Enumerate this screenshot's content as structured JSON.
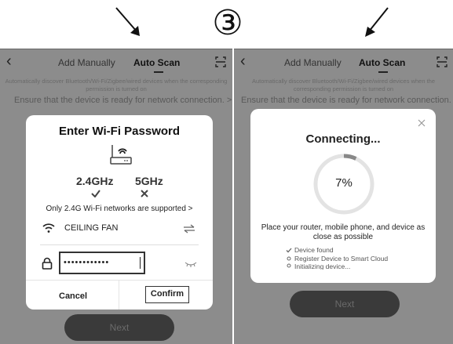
{
  "step_number": "③",
  "left_screen": {
    "back_icon": "chevron-left-icon",
    "tabs": [
      {
        "label": "Add Manually"
      },
      {
        "label": "Auto Scan"
      }
    ],
    "scan_icon": "scan-icon",
    "description": "Automatically discover Bluetooth/Wi-Fi/Zigbee/wired devices when the corresponding permission is turned on",
    "ensure_text": "Ensure that the device is ready for network connection. >",
    "dialog": {
      "title": "Enter Wi-Fi Password",
      "router_icon": "router-icon",
      "band_24": "2.4GHz",
      "band_5": "5GHz",
      "band_24_status_icon": "check-icon",
      "band_5_status_icon": "cross-icon",
      "note": "Only 2.4G Wi-Fi networks are supported >",
      "wifi_icon": "wifi-icon",
      "ssid": "CEILING FAN",
      "switch_icon": "switch-network-icon",
      "lock_icon": "lock-icon",
      "password_masked": "••••••••••••",
      "eye_icon": "eye-closed-icon",
      "cancel_label": "Cancel",
      "confirm_label": "Confirm"
    },
    "next_label": "Next"
  },
  "right_screen": {
    "back_icon": "chevron-left-icon",
    "tabs": [
      {
        "label": "Add Manually"
      },
      {
        "label": "Auto Scan"
      }
    ],
    "scan_icon": "scan-icon",
    "description": "Automatically discover Bluetooth/Wi-Fi/Zigbee/wired devices when the corresponding permission is turned on",
    "ensure_text": "Ensure that the device is ready for network connection.",
    "dialog": {
      "close_icon": "close-icon",
      "title": "Connecting...",
      "progress_text": "7%",
      "progress_fraction": 0.07,
      "instruction": "Place your router, mobile phone, and device as close as possible",
      "steps": [
        {
          "label": "Device found",
          "icon": "check-icon"
        },
        {
          "label": "Register Device to Smart Cloud",
          "icon": "dot-icon"
        },
        {
          "label": "Initializing device...",
          "icon": "dot-icon"
        }
      ]
    },
    "next_label": "Next"
  },
  "colors": {
    "overlay": "#8c8c8c",
    "button": "#3a3a3a",
    "progress": "#888888"
  }
}
